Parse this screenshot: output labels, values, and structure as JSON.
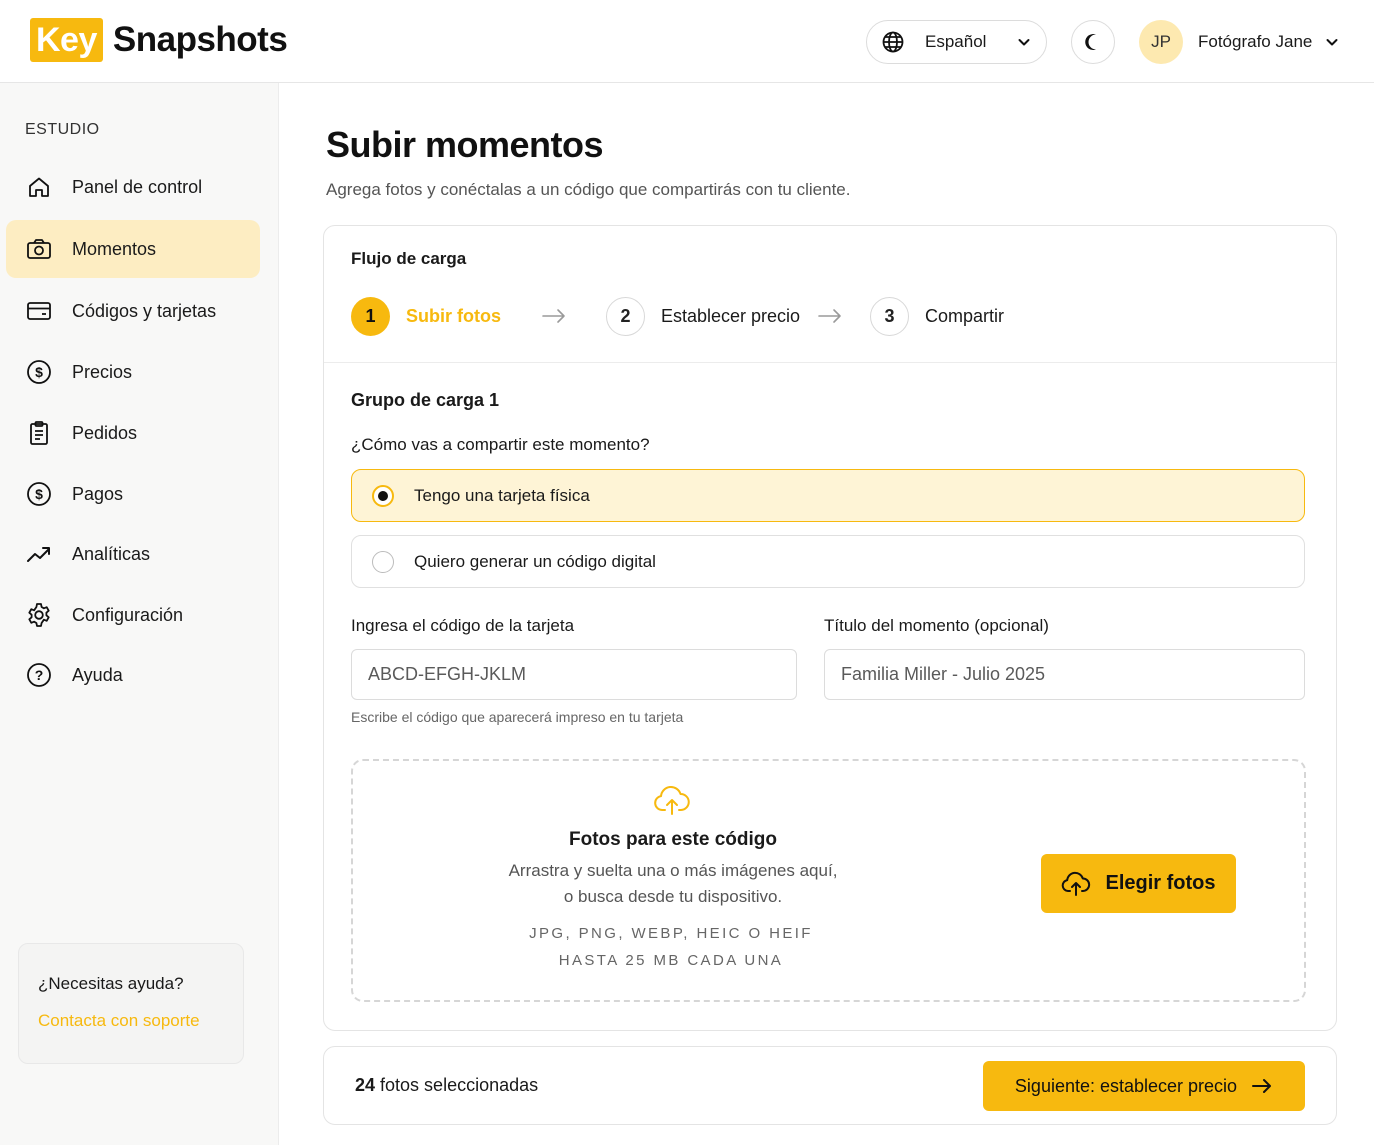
{
  "brand": {
    "logo_key": "Key",
    "logo_rest": "Snapshots"
  },
  "header": {
    "language": {
      "icon": "globe-icon",
      "label": "Español"
    },
    "theme_toggle_icon": "moon-icon",
    "user": {
      "initials": "JP",
      "name": "Fotógrafo Jane"
    }
  },
  "sidebar": {
    "section_title": "ESTUDIO",
    "items": [
      {
        "label": "Panel de control",
        "icon": "home-icon",
        "active": false
      },
      {
        "label": "Momentos",
        "icon": "camera-icon",
        "active": true
      },
      {
        "label": "Códigos y tarjetas",
        "icon": "card-icon",
        "active": false
      },
      {
        "label": "Precios",
        "icon": "dollar-icon",
        "active": false
      },
      {
        "label": "Pedidos",
        "icon": "clipboard-icon",
        "active": false
      },
      {
        "label": "Pagos",
        "icon": "dollar-icon",
        "active": false
      },
      {
        "label": "Analíticas",
        "icon": "trend-icon",
        "active": false
      },
      {
        "label": "Configuración",
        "icon": "gear-icon",
        "active": false
      },
      {
        "label": "Ayuda",
        "icon": "help-icon",
        "active": false
      }
    ],
    "help": {
      "title": "¿Necesitas ayuda?",
      "link": "Contacta con soporte"
    }
  },
  "page": {
    "title": "Subir momentos",
    "subtitle": "Agrega fotos y conéctalas a un código que compartirás con tu cliente."
  },
  "flow": {
    "title": "Flujo de carga",
    "steps": [
      {
        "num": "1",
        "label": "Subir fotos",
        "active": true
      },
      {
        "num": "2",
        "label": "Establecer precio",
        "active": false
      },
      {
        "num": "3",
        "label": "Compartir",
        "active": false
      }
    ]
  },
  "group": {
    "title": "Grupo de carga 1",
    "question": "¿Cómo vas a compartir este momento?",
    "options": [
      {
        "label": "Tengo una tarjeta física",
        "selected": true
      },
      {
        "label": "Quiero generar un código digital",
        "selected": false
      }
    ],
    "card_code": {
      "label": "Ingresa el código de la tarjeta",
      "placeholder": "ABCD-EFGH-JKLM",
      "value": "",
      "hint": "Escribe el código que aparecerá impreso en tu tarjeta"
    },
    "moment_title": {
      "label": "Título del momento (opcional)",
      "placeholder": "Familia Miller - Julio 2025",
      "value": ""
    },
    "dropzone": {
      "icon": "cloud-upload-icon",
      "title": "Fotos para este código",
      "line1": "Arrastra y suelta una o más imágenes aquí,",
      "line2": "o busca desde tu dispositivo.",
      "formats": "JPG, PNG, WEBP, HEIC O HEIF",
      "limit": "HASTA 25 MB CADA UNA",
      "button": "Elegir fotos"
    }
  },
  "footer": {
    "count": "24",
    "count_suffix": " fotos seleccionadas",
    "next_button": "Siguiente: establecer precio"
  },
  "colors": {
    "accent": "#f7b90f",
    "accent_light": "#fdedc2",
    "selected_bg": "#fef4d6"
  }
}
